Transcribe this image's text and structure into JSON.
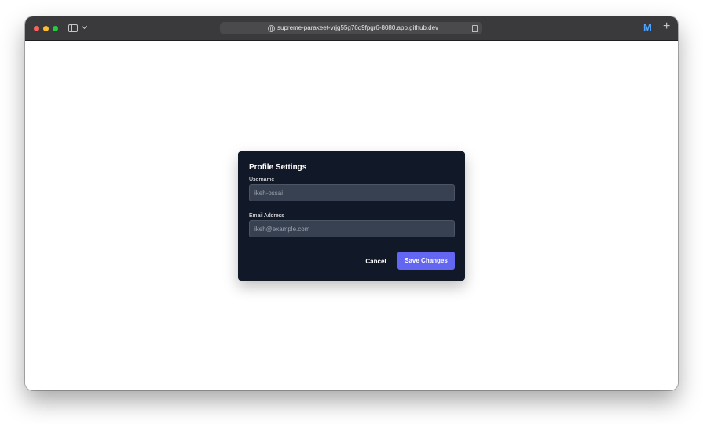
{
  "browser": {
    "url": "supreme-parakeet-vrjg55g76q9fpgr6-8080.app.github.dev",
    "extension_label": "M",
    "new_tab_label": "+"
  },
  "icons": {
    "traffic_lights": [
      "close-icon",
      "minimize-icon",
      "zoom-icon"
    ],
    "sidebar": "sidebar-toggle-icon",
    "address": "globe-icon",
    "reader": "reader-icon"
  },
  "colors": {
    "modal_bg": "#111827",
    "input_bg": "#374151",
    "primary": "#6366f1",
    "titlebar": "#3a3a3c"
  },
  "modal": {
    "title": "Profile Settings",
    "username_label": "Username",
    "username_placeholder": "ikeh-ossai",
    "email_label": "Email Address",
    "email_placeholder": "ikeh@example.com",
    "cancel_label": "Cancel",
    "save_label": "Save Changes"
  }
}
